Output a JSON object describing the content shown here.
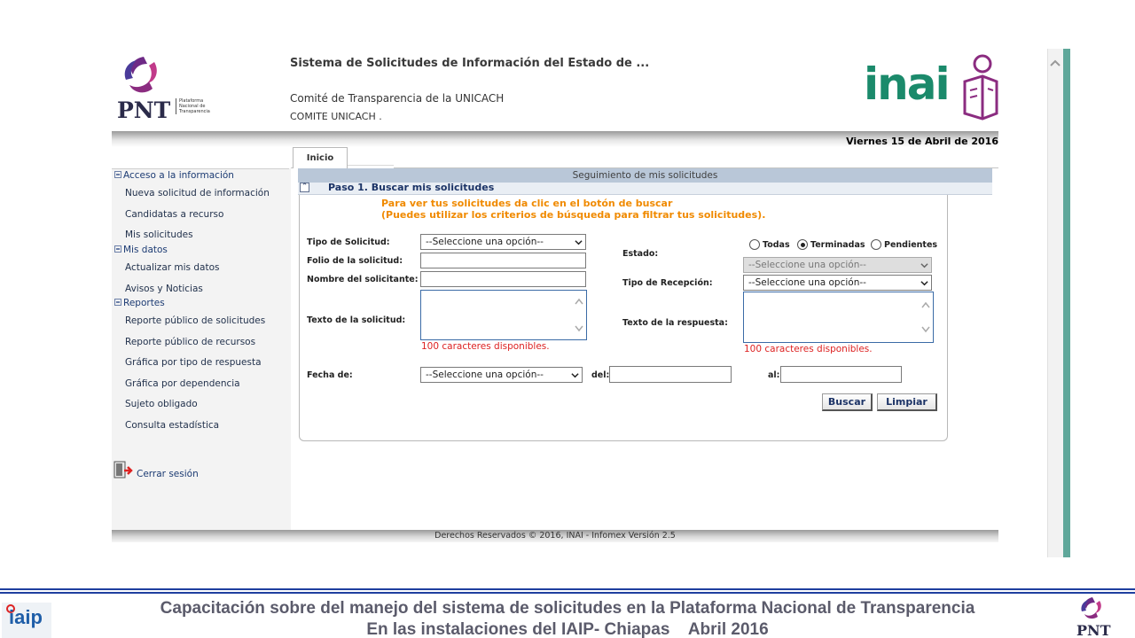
{
  "header": {
    "logo_text": "PNT",
    "logo_sub": [
      "Plataforma",
      "Nacional de",
      "Transparencia"
    ],
    "system_title": "Sistema de Solicitudes de Información del Estado de ...",
    "committee": "Comité de Transparencia de la UNICACH",
    "committee_short": "COMITE UNICACH .",
    "inai_text": "inai",
    "date": "Viernes 15 de Abril de 2016"
  },
  "sidebar": {
    "sections": [
      {
        "label": "Acceso a la información",
        "items": [
          "Nueva solicitud de información",
          "Candidatas a recurso",
          "Mis solicitudes"
        ]
      },
      {
        "label": "Mis datos",
        "items": [
          "Actualizar mis datos",
          "Avisos y Noticias"
        ]
      },
      {
        "label": "Reportes",
        "items": [
          "Reporte público de solicitudes",
          "Reporte público de recursos",
          "Gráfica por tipo de respuesta",
          "Gráfica por dependencia",
          "Sujeto obligado",
          "Consulta estadística"
        ]
      }
    ],
    "logout": "Cerrar sesión"
  },
  "tabs": {
    "active": "Inicio"
  },
  "main": {
    "section_title": "Seguimiento de mis solicitudes",
    "step_title": "Paso 1. Buscar mis solicitudes",
    "note1": "Para ver tus solicitudes da clic en el botón de buscar",
    "note2": "(Puedes utilizar los criterios de búsqueda para filtrar tus solicitudes)."
  },
  "form": {
    "tipo_solicitud": {
      "label": "Tipo de Solicitud:",
      "value": "--Seleccione una opción--"
    },
    "folio": {
      "label": "Folio de la solicitud:",
      "value": ""
    },
    "nombre": {
      "label": "Nombre del solicitante:",
      "value": ""
    },
    "texto_solicitud": {
      "label": "Texto de la solicitud:",
      "remaining": "100 caracteres disponibles."
    },
    "estado": {
      "label": "Estado:",
      "options": [
        "Todas",
        "Terminadas",
        "Pendientes"
      ],
      "selected": "Terminadas",
      "select_value": "--Seleccione una opción--"
    },
    "tipo_recepcion": {
      "label": "Tipo de Recepción:",
      "value": "--Seleccione una opción--"
    },
    "texto_respuesta": {
      "label": "Texto de la respuesta:",
      "remaining": "100 caracteres disponibles."
    },
    "fecha": {
      "label": "Fecha de:",
      "value": "--Seleccione una opción--",
      "del_label": "del:",
      "al_label": "al:",
      "del_value": "",
      "al_value": ""
    },
    "buttons": {
      "buscar": "Buscar",
      "limpiar": "Limpiar"
    }
  },
  "footer": {
    "copyright": "Derechos Reservados © 2016, INAI - Infomex Versión 2.5"
  },
  "slide": {
    "line1": "Capacitación sobre del manejo del sistema de solicitudes en la Plataforma Nacional de Transparencia",
    "line2": "En las instalaciones del IAIP- Chiapas    Abril 2016",
    "iaip_text": "iaip"
  },
  "colors": {
    "accent_orange": "#f08a00",
    "error_red": "#dd2222",
    "inai_green": "#1b8a6b",
    "inai_purple": "#8b2c80",
    "navy": "#1c3366"
  }
}
